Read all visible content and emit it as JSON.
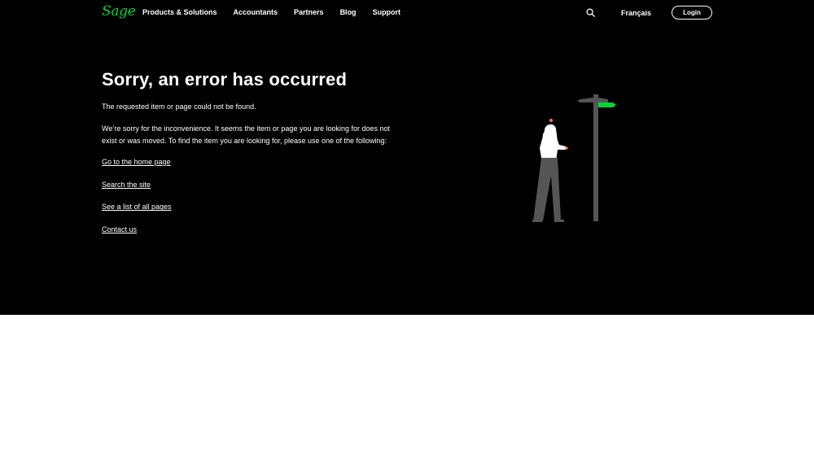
{
  "brand": {
    "logo_text": "Sage",
    "accent": "#00d639"
  },
  "nav": {
    "items": [
      {
        "label": "Products & Solutions"
      },
      {
        "label": "Accountants"
      },
      {
        "label": "Partners"
      },
      {
        "label": "Blog"
      },
      {
        "label": "Support"
      }
    ],
    "search_icon": "search-icon",
    "language": "Français",
    "login": "Login"
  },
  "error": {
    "title": "Sorry, an error has occurred",
    "message": "The requested item or page could not be found.",
    "apology": "We’re sorry for the inconvenience. It seems the item or page you are looking for does not exist or was moved. To find the item you are looking for, please use one of the following:",
    "links": [
      {
        "label": "Go to the home page"
      },
      {
        "label": "Search the site"
      },
      {
        "label": "See a list of all pages"
      },
      {
        "label": "Contact us"
      }
    ]
  },
  "colors": {
    "hero_background": "#000000",
    "page_background": "#ffffff"
  }
}
